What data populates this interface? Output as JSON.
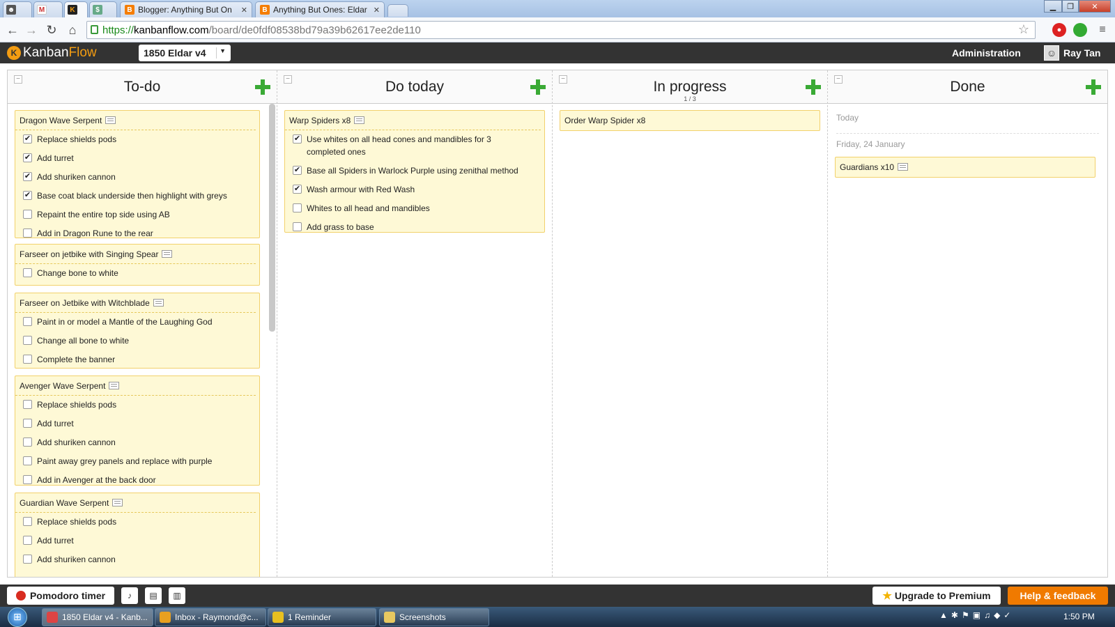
{
  "browser": {
    "tabs": [
      {
        "label": "Blogger: Anything But On"
      },
      {
        "label": "Anything But Ones: Eldar"
      }
    ],
    "url": {
      "scheme": "https://",
      "host": "kanbanflow.com",
      "path": "/board/de0fdf08538bd79a39b62617ee2de110"
    }
  },
  "app": {
    "logo_kanban": "Kanban",
    "logo_flow": "Flow",
    "board_name": "1850 Eldar v4",
    "administration": "Administration",
    "user_name": "Ray Tan"
  },
  "columns": [
    {
      "title": "To-do",
      "cards": [
        {
          "title": "Dragon Wave Serpent",
          "subtasks": [
            {
              "text": "Replace shields pods",
              "done": true
            },
            {
              "text": "Add turret",
              "done": true
            },
            {
              "text": "Add shuriken cannon",
              "done": true
            },
            {
              "text": "Base coat black underside then highlight with greys",
              "done": true
            },
            {
              "text": "Repaint the entire top side using AB",
              "done": false
            },
            {
              "text": "Add in Dragon Rune to the rear",
              "done": false
            }
          ]
        },
        {
          "title": "Farseer on jetbike with Singing Spear",
          "subtasks": [
            {
              "text": "Change bone to white",
              "done": false
            }
          ]
        },
        {
          "title": "Farseer on Jetbike with Witchblade",
          "subtasks": [
            {
              "text": "Paint in or model a Mantle of the Laughing God",
              "done": false
            },
            {
              "text": "Change all bone to white",
              "done": false
            },
            {
              "text": "Complete the banner",
              "done": false
            }
          ]
        },
        {
          "title": "Avenger Wave Serpent",
          "subtasks": [
            {
              "text": "Replace shields pods",
              "done": false
            },
            {
              "text": "Add turret",
              "done": false
            },
            {
              "text": "Add shuriken cannon",
              "done": false
            },
            {
              "text": "Paint away grey panels and replace with purple",
              "done": false
            },
            {
              "text": "Add in Avenger at the back door",
              "done": false
            }
          ]
        },
        {
          "title": "Guardian Wave Serpent",
          "subtasks": [
            {
              "text": "Replace shields pods",
              "done": false
            },
            {
              "text": "Add turret",
              "done": false
            },
            {
              "text": "Add shuriken cannon",
              "done": false
            }
          ]
        }
      ]
    },
    {
      "title": "Do today",
      "cards": [
        {
          "title": "Warp Spiders x8",
          "subtasks": [
            {
              "text": "Use whites on all head cones and mandibles for 3 completed ones",
              "done": true
            },
            {
              "text": "Base all Spiders in Warlock Purple using zenithal method",
              "done": true
            },
            {
              "text": "Wash armour with Red Wash",
              "done": true
            },
            {
              "text": "Whites to all head and mandibles",
              "done": false
            },
            {
              "text": "Add grass to base",
              "done": false
            }
          ]
        }
      ]
    },
    {
      "title": "In progress",
      "count": "1 / 3",
      "cards": [
        {
          "title": "Order Warp Spider x8",
          "subtasks": []
        }
      ]
    },
    {
      "title": "Done",
      "today_label": "Today",
      "date_label": "Friday, 24 January",
      "cards": [
        {
          "title": "Guardians x10",
          "subtasks": []
        }
      ]
    }
  ],
  "footer": {
    "pomodoro": "Pomodoro timer",
    "upgrade": "Upgrade to Premium",
    "help": "Help & feedback"
  },
  "taskbar": {
    "items": [
      "1850 Eldar v4 - Kanb...",
      "Inbox - Raymond@c...",
      "1 Reminder",
      "Screenshots"
    ],
    "clock": "1:50 PM"
  },
  "colors": {
    "card_bg": "#fef9d6",
    "card_border": "#f2d16b",
    "add_green": "#3aaa35",
    "brand_orange": "#f39c12",
    "help_orange": "#f07a00"
  }
}
